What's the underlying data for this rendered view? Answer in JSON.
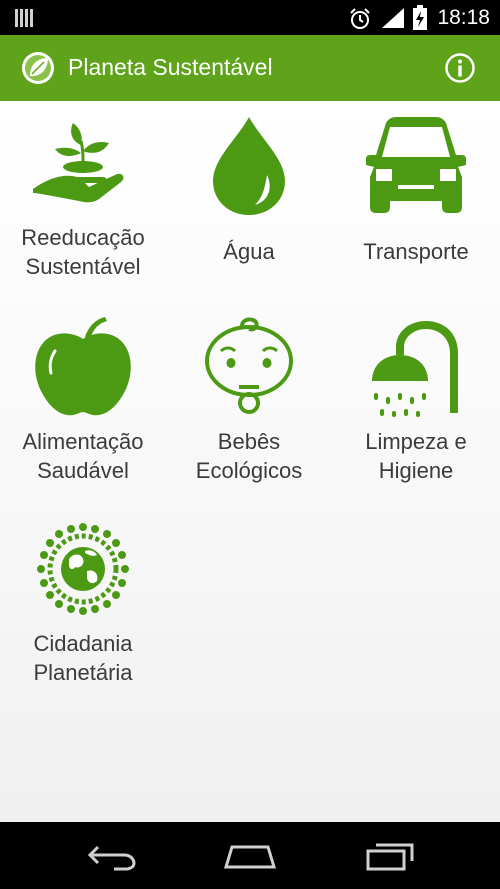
{
  "status_bar": {
    "time": "18:18",
    "icons": [
      "notification-icon",
      "alarm-clock-icon",
      "signal-icon",
      "battery-charging-icon"
    ]
  },
  "action_bar": {
    "title": "Planeta Sustentável",
    "app_icon": "leaf-globe-icon",
    "info_icon": "info-icon"
  },
  "tiles": [
    {
      "label": "Reeducação\nSustentável",
      "icon": "hand-plant-icon"
    },
    {
      "label": "Água",
      "icon": "water-drop-icon"
    },
    {
      "label": "Transporte",
      "icon": "car-icon"
    },
    {
      "label": "Alimentação\nSaudável",
      "icon": "apple-icon"
    },
    {
      "label": "Bebês\nEcológicos",
      "icon": "baby-face-icon"
    },
    {
      "label": "Limpeza e\nHigiene",
      "icon": "shower-icon"
    },
    {
      "label": "Cidadania\nPlanetária",
      "icon": "globe-people-icon"
    }
  ],
  "nav_bar": {
    "icons": [
      "back-icon",
      "home-icon",
      "recent-apps-icon"
    ]
  },
  "colors": {
    "accent": "#5ea31a",
    "icon_green": "#4c9a14",
    "label_text": "#3b3b3b"
  }
}
